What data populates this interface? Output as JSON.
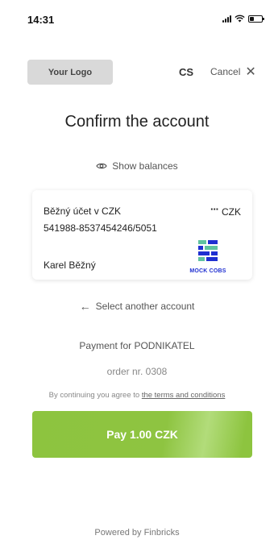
{
  "status_bar": {
    "time": "14:31"
  },
  "header": {
    "logo_text": "Your Logo",
    "language": "CS",
    "cancel_label": "Cancel",
    "close_symbol": "✕"
  },
  "title": "Confirm the account",
  "show_balances_label": "Show balances",
  "account": {
    "name": "Běžný účet v CZK",
    "number": "541988-8537454246/5051",
    "currency": "CZK",
    "more_symbol": "···",
    "holder": "Karel Běžný",
    "bank_logo_text": "MOCK COBS"
  },
  "select_another_label": "Select another account",
  "payment": {
    "payment_for": "Payment for PODNIKATEL",
    "order": "order nr. 0308"
  },
  "terms": {
    "prefix": "By continuing you agree to",
    "link": "the terms and conditions"
  },
  "pay_button_label": "Pay 1.00 CZK",
  "footer": "Powered by Finbricks",
  "colors": {
    "pay_button": "#8dc43f",
    "bank_logo_blue": "#1f2fd1",
    "bank_logo_green": "#5fc2a0"
  }
}
